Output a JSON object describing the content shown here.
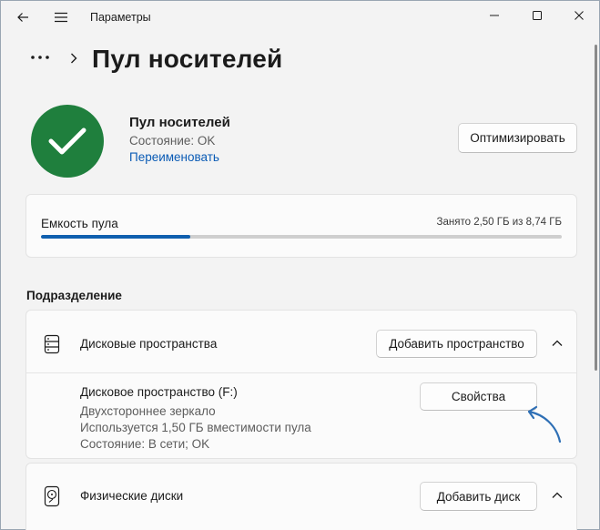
{
  "window": {
    "title": "Параметры"
  },
  "header": {
    "page_title": "Пул носителей"
  },
  "pool": {
    "name": "Пул носителей",
    "state": "Состояние: OK",
    "rename_label": "Переименовать",
    "optimize_label": "Оптимизировать"
  },
  "capacity": {
    "label": "Емкость пула",
    "used_text": "Занято 2,50 ГБ из 8,74 ГБ",
    "used_fraction": 0.286
  },
  "subdivision": {
    "title": "Подразделение"
  },
  "storage_spaces": {
    "label": "Дисковые пространства",
    "add_label": "Добавить пространство",
    "items": [
      {
        "name": "Дисковое пространство (F:)",
        "type": "Двухстороннее зеркало",
        "usage": "Используется 1,50 ГБ вместимости пула",
        "state": "Состояние: В сети; OK",
        "properties_label": "Свойства"
      }
    ]
  },
  "physical_disks": {
    "label": "Физические диски",
    "add_label": "Добавить диск"
  },
  "colors": {
    "accent": "#0f5fae",
    "status_ok": "#1f7f3d",
    "link": "#0a5bb5",
    "annotation_arrow": "#2e6fb5"
  },
  "icons": {
    "back": "back-arrow-icon",
    "menu": "hamburger-menu-icon",
    "minimize": "minimize-icon",
    "maximize": "maximize-icon",
    "close": "close-icon",
    "more": "more-dots-icon",
    "breadcrumb": "chevron-right-icon",
    "status": "checkmark-icon",
    "spaces": "storage-stack-icon",
    "disks": "hard-disk-icon",
    "collapse": "chevron-up-icon"
  }
}
